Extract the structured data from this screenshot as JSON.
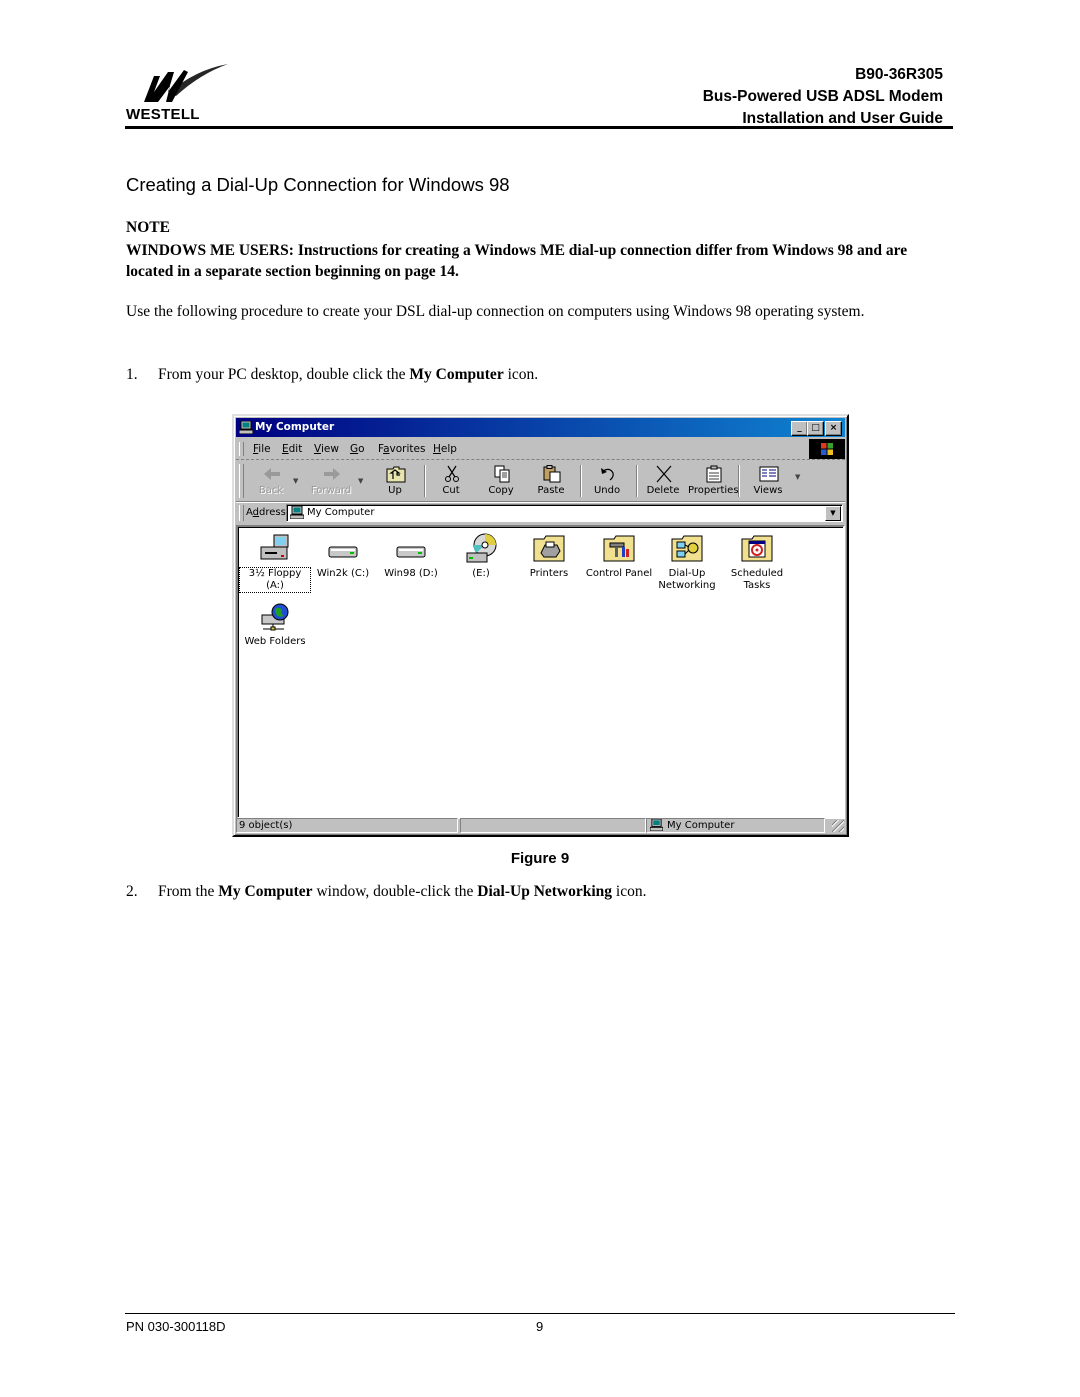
{
  "header": {
    "brand": "WESTELL",
    "doc_number": "B90-36R305",
    "product": "Bus-Powered USB ADSL Modem",
    "guide": "Installation and User Guide"
  },
  "section_title": "Creating a Dial-Up Connection for Windows 98",
  "note": {
    "label": "NOTE",
    "text": "WINDOWS ME USERS:  Instructions for creating a Windows ME dial-up connection differ from Windows 98 and are located in a separate section beginning on page 14."
  },
  "intro": "Use the following procedure to create your DSL dial-up connection on computers using Windows 98 operating system.",
  "steps": [
    {
      "num": "1.",
      "pre": "From your PC desktop, double click the ",
      "bold1": "My Computer",
      "mid": " icon.",
      "bold2": "",
      "post": ""
    },
    {
      "num": "2.",
      "pre": "From the ",
      "bold1": "My Computer",
      "mid": " window, double-click the ",
      "bold2": "Dial-Up Networking",
      "post": " icon."
    }
  ],
  "figure_caption": "Figure 9",
  "window": {
    "title": "My Computer",
    "controls": {
      "minimize": "_",
      "maximize": "□",
      "close": "×"
    },
    "menu": [
      {
        "label": "File",
        "accel": "F",
        "rest": "ile"
      },
      {
        "label": "Edit",
        "accel": "E",
        "rest": "dit"
      },
      {
        "label": "View",
        "accel": "V",
        "rest": "iew"
      },
      {
        "label": "Go",
        "accel": "G",
        "rest": "o"
      },
      {
        "label": "Favorites",
        "pre": "F",
        "accel": "a",
        "rest": "vorites"
      },
      {
        "label": "Help",
        "accel": "H",
        "rest": "elp"
      }
    ],
    "toolbar": [
      {
        "label": "Back",
        "icon": "back-arrow-icon",
        "enabled": false
      },
      {
        "label": "Forward",
        "icon": "forward-arrow-icon",
        "enabled": false
      },
      {
        "label": "Up",
        "icon": "up-folder-icon",
        "enabled": true
      },
      {
        "label": "Cut",
        "icon": "scissors-icon",
        "enabled": true
      },
      {
        "label": "Copy",
        "icon": "copy-icon",
        "enabled": true
      },
      {
        "label": "Paste",
        "icon": "paste-icon",
        "enabled": true
      },
      {
        "label": "Undo",
        "icon": "undo-icon",
        "enabled": true
      },
      {
        "label": "Delete",
        "icon": "delete-x-icon",
        "enabled": true
      },
      {
        "label": "Properties",
        "icon": "properties-icon",
        "enabled": true
      },
      {
        "label": "Views",
        "icon": "views-icon",
        "enabled": true
      }
    ],
    "address": {
      "label": "Address",
      "accel": "d",
      "value": "My Computer"
    },
    "items": [
      {
        "label": "3½ Floppy (A:)",
        "icon": "floppy-drive-icon",
        "selected": true
      },
      {
        "label": "Win2k (C:)",
        "icon": "hard-drive-icon",
        "selected": false
      },
      {
        "label": "Win98 (D:)",
        "icon": "hard-drive-icon",
        "selected": false
      },
      {
        "label": "(E:)",
        "icon": "cd-drive-icon",
        "selected": false
      },
      {
        "label": "Printers",
        "icon": "printers-folder-icon",
        "selected": false
      },
      {
        "label": "Control Panel",
        "icon": "control-panel-icon",
        "selected": false
      },
      {
        "label": "Dial-Up Networking",
        "line1": "Dial-Up",
        "line2": "Networking",
        "icon": "dialup-networking-icon",
        "selected": false
      },
      {
        "label": "Scheduled Tasks",
        "line1": "Scheduled",
        "line2": "Tasks",
        "icon": "scheduled-tasks-icon",
        "selected": false
      },
      {
        "label": "Web Folders",
        "icon": "web-folders-icon",
        "selected": false
      }
    ],
    "status": {
      "objects": "9 object(s)",
      "middle": "",
      "zone": "My Computer"
    }
  },
  "footer": {
    "part_number": "PN 030-300118D",
    "page": "9"
  }
}
